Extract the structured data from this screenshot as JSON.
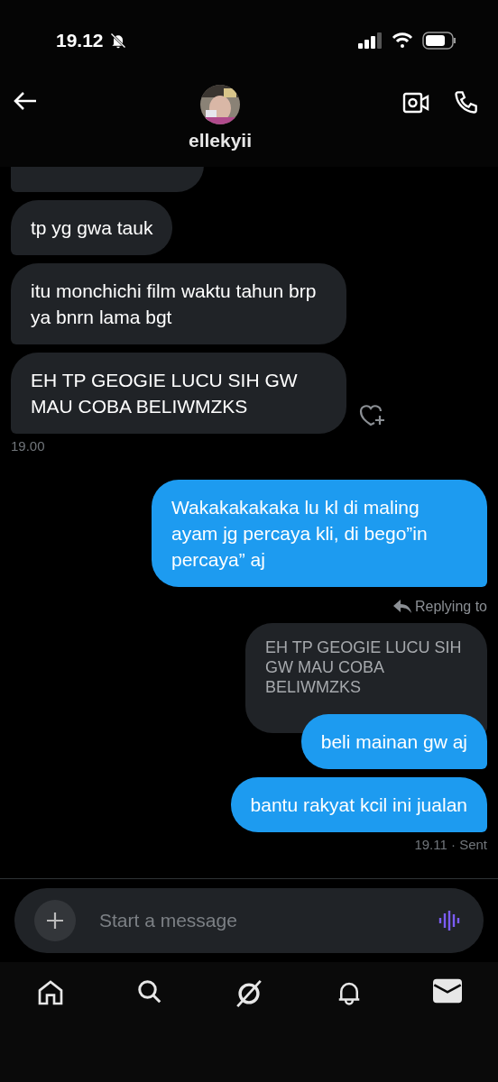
{
  "status_bar": {
    "time": "19.12",
    "silent": true
  },
  "header": {
    "name": "ellekyii"
  },
  "messages": [
    {
      "kind": "clipped_bubble"
    },
    {
      "kind": "received",
      "text": "tp yg gwa tauk"
    },
    {
      "kind": "received",
      "text": "itu monchichi film waktu tahun brp ya bnrn lama bgt"
    },
    {
      "kind": "received",
      "text": "EH TP GEOGIE LUCU SIH GW MAU COBA BELIWMZKS",
      "react": true
    },
    {
      "kind": "received_time",
      "text": "19.00"
    },
    {
      "kind": "sent",
      "text": "Wakakakakaka lu kl di maling ayam jg percaya kli, di bego”in percaya” aj"
    },
    {
      "kind": "reply_label",
      "text": "Replying to"
    },
    {
      "kind": "quote",
      "text": "EH TP GEOGIE LUCU SIH GW MAU COBA BELIWMZKS"
    },
    {
      "kind": "sent",
      "text": "beli mainan gw aj",
      "overlap": true
    },
    {
      "kind": "sent",
      "text": "bantu rakyat kcil ini jualan"
    },
    {
      "kind": "sent_time",
      "text": "19.11 · Sent"
    }
  ],
  "composer": {
    "placeholder": "Start a message"
  },
  "nav": [
    {
      "selected": false
    },
    {
      "selected": false
    },
    {
      "selected": false
    },
    {
      "selected": false
    },
    {
      "selected": true
    }
  ]
}
